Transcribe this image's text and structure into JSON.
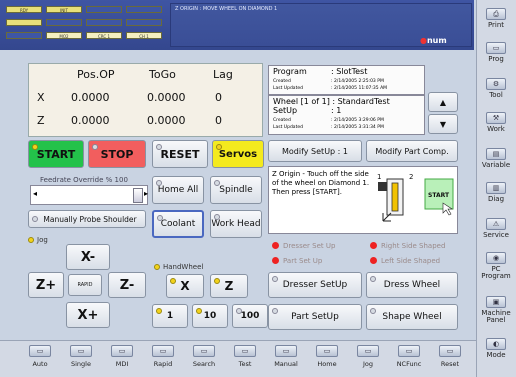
{
  "status_message": "Z ORIGIN : MOVE WHEEL ON DIAMOND 1",
  "status_lights": [
    "RDY",
    "INIT",
    "",
    "",
    "",
    "",
    "",
    "",
    "",
    "MO2",
    "CRC 1",
    "CH 1"
  ],
  "brand": "num",
  "positions": {
    "headers": [
      "Pos.OP",
      "ToGo",
      "Lag"
    ],
    "rows": [
      {
        "axis": "X",
        "pos": "0.0000",
        "togo": "0.0000",
        "lag": "0"
      },
      {
        "axis": "Z",
        "pos": "0.0000",
        "togo": "0.0000",
        "lag": "0"
      }
    ]
  },
  "program": {
    "label": "Program",
    "name": ": SlotTest",
    "created_label": "Created",
    "created": ": 2/14/2005 2:25:03 PM",
    "updated_label": "Last Updated",
    "updated": ": 2/14/2005 11:07:35 AM"
  },
  "setup": {
    "wheel": "Wheel [1 of 1] : StandardTest",
    "label": "SetUp",
    "value": ": 1",
    "created_label": "Created",
    "created": ": 2/14/2005 3:29:06 PM",
    "updated_label": "Last Updated",
    "updated": ": 2/14/2005 3:31:34 PM"
  },
  "controls": {
    "start": "START",
    "stop": "STOP",
    "reset": "RESET",
    "servos": "Servos"
  },
  "modify": {
    "setup": "Modify  SetUp : 1",
    "part": "Modify Part Comp."
  },
  "instructions": "Z Origin - Touch off the side of the wheel on Diamond 1. Then press [START].",
  "diagram": {
    "label1": "1",
    "label2": "2",
    "start": "START"
  },
  "feedrate": {
    "label": "Feedrate Override % 100",
    "percent": 100
  },
  "buttons": {
    "home_all": "Home All",
    "spindle": "Spindle",
    "coolant": "Coolant",
    "work_head": "Work Head",
    "probe": "Manually Probe Shoulder"
  },
  "jog": {
    "label": "Jog",
    "x_minus": "X-",
    "z_plus": "Z+",
    "rapid": "RAPID",
    "z_minus": "Z-",
    "x_plus": "X+"
  },
  "handwheel": {
    "label": "HandWheel",
    "x": "X",
    "z": "Z",
    "s1": "1",
    "s10": "10",
    "s100": "100"
  },
  "indicators": {
    "dresser_setup": "Dresser Set Up",
    "part_setup": "Part Set Up",
    "right_side": "Right Side Shaped",
    "left_side": "Left Side Shaped"
  },
  "actions": {
    "dresser_setup": "Dresser SetUp",
    "dress_wheel": "Dress Wheel",
    "part_setup": "Part SetUp",
    "shape_wheel": "Shape Wheel"
  },
  "sidebar": [
    "Print",
    "Prog",
    "Tool",
    "Work",
    "Variable",
    "Diag",
    "Service",
    "PC\nProgram",
    "Machine\nPanel",
    "Mode"
  ],
  "bottom": [
    "Auto",
    "Single",
    "MDI",
    "Rapid",
    "Search",
    "Test",
    "Manual",
    "Home",
    "Jog",
    "NCFunc",
    "Reset"
  ]
}
